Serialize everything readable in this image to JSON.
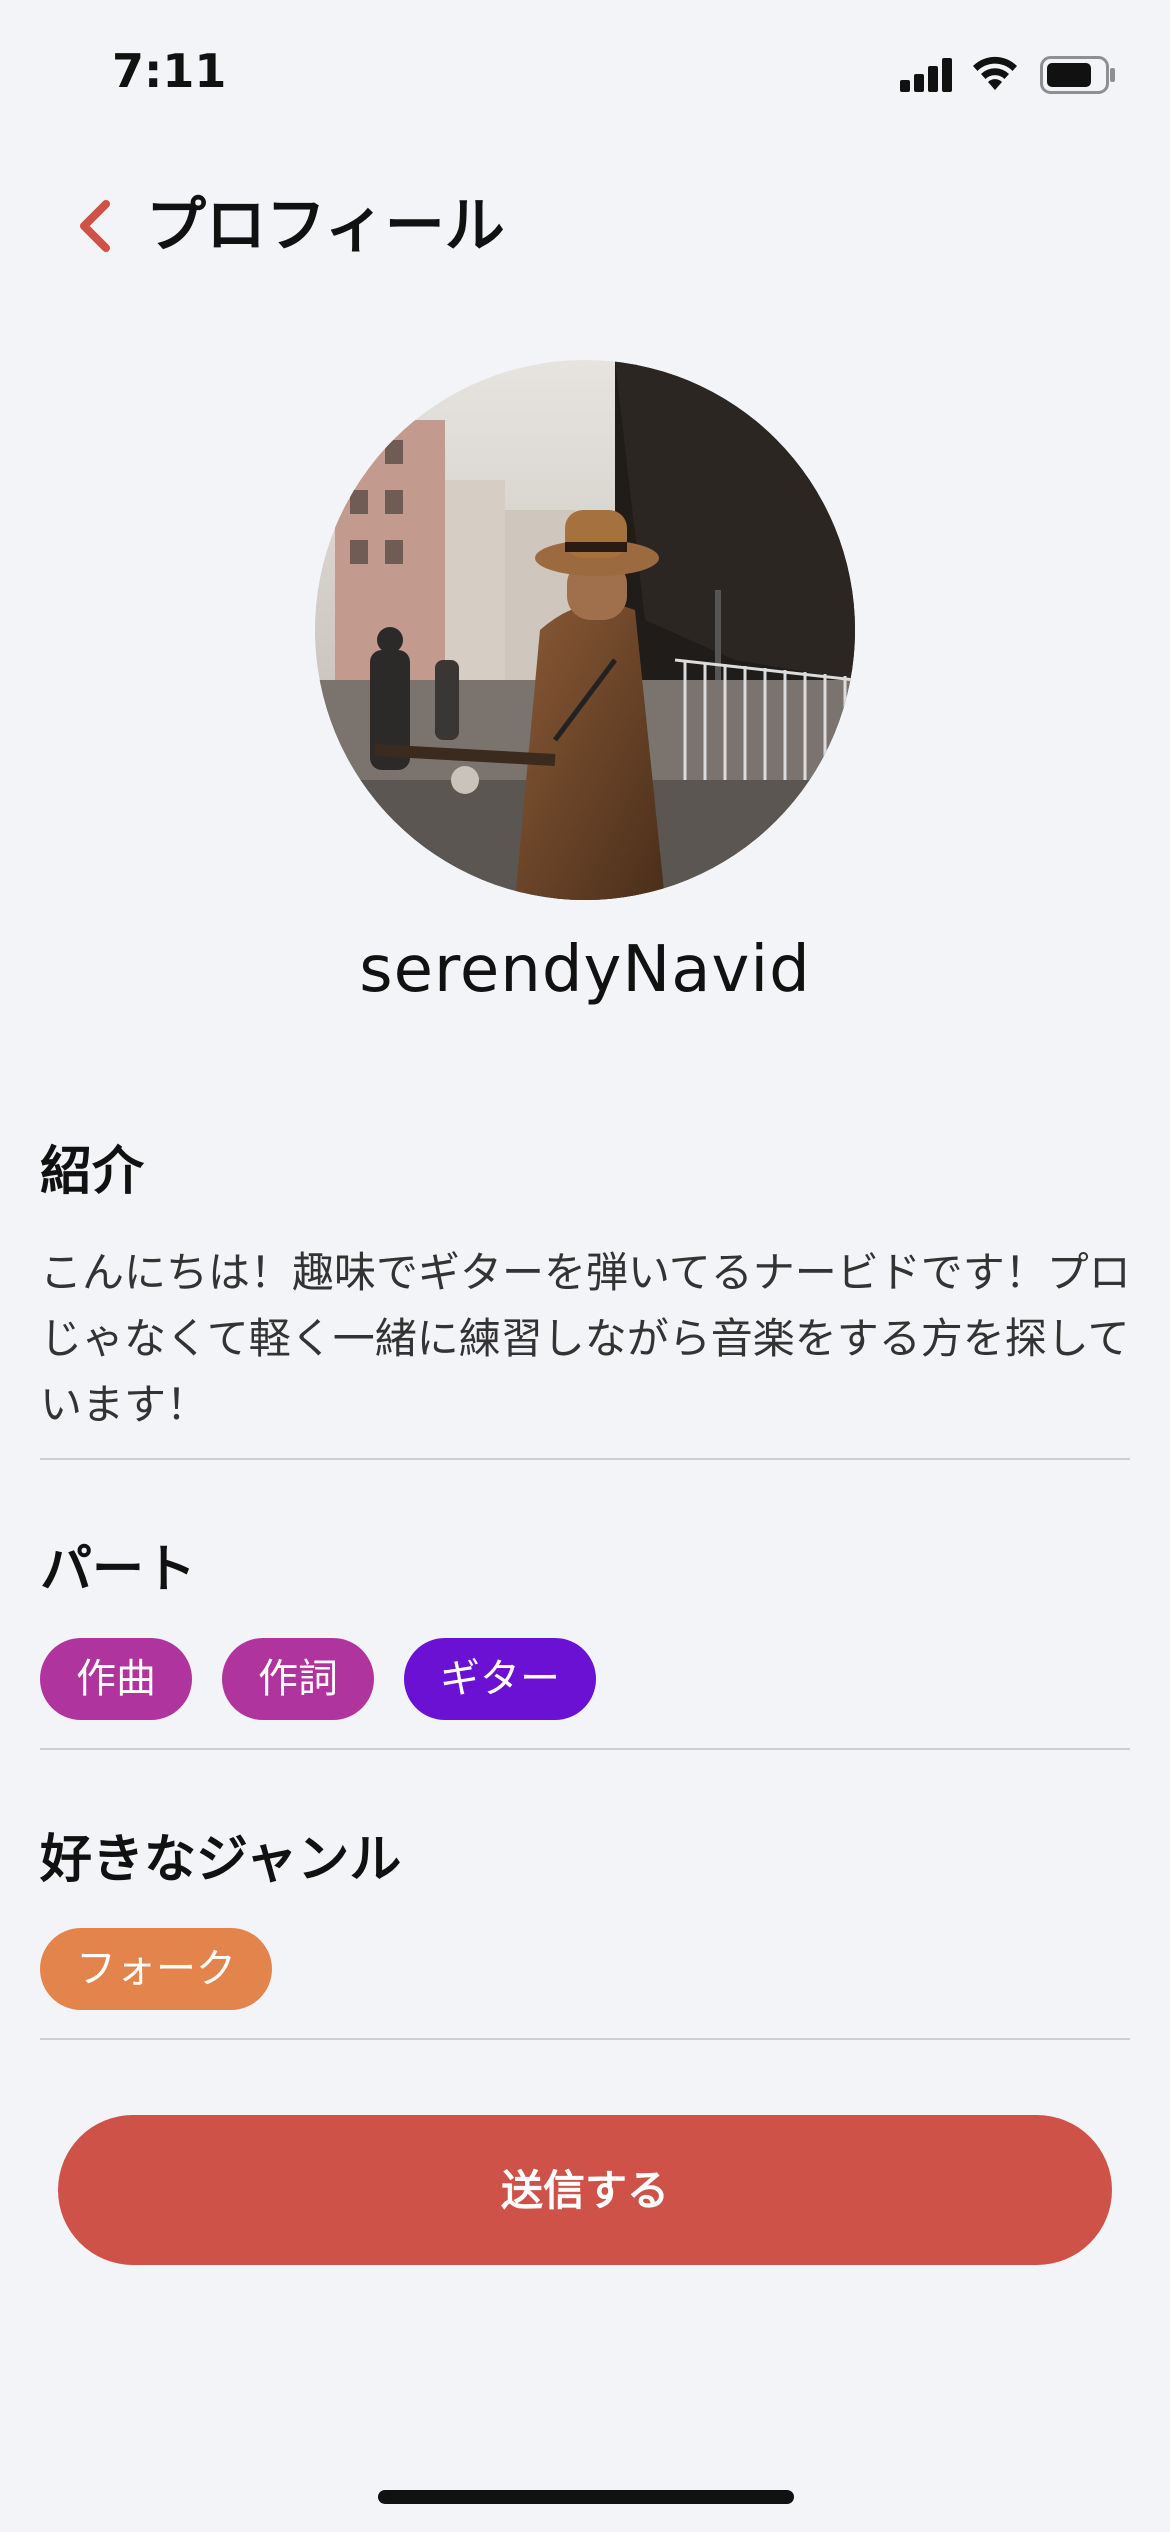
{
  "status_bar": {
    "time": "7:11",
    "icons": [
      "signal-icon",
      "wifi-icon",
      "battery-icon"
    ]
  },
  "header": {
    "title": "プロフィール",
    "back_icon": "chevron-left-icon"
  },
  "profile": {
    "avatar": "avatar-photo",
    "username": "serendyNavid"
  },
  "intro": {
    "heading": "紹介",
    "text": "こんにちは！趣味でギターを弾いてるナービドです！プロじゃなくて軽く一緒に練習しながら音楽をする方を探しています！"
  },
  "parts": {
    "heading": "パート",
    "chips": [
      {
        "label": "作曲",
        "color": "#b0349e"
      },
      {
        "label": "作詞",
        "color": "#b0349e"
      },
      {
        "label": "ギター",
        "color": "#6a11d4"
      }
    ]
  },
  "genres": {
    "heading": "好きなジャンル",
    "chips": [
      {
        "label": "フォーク",
        "color": "#e4844d"
      }
    ]
  },
  "actions": {
    "send_label": "送信する"
  },
  "colors": {
    "accent": "#cf5248",
    "background": "#f3f4f8"
  }
}
